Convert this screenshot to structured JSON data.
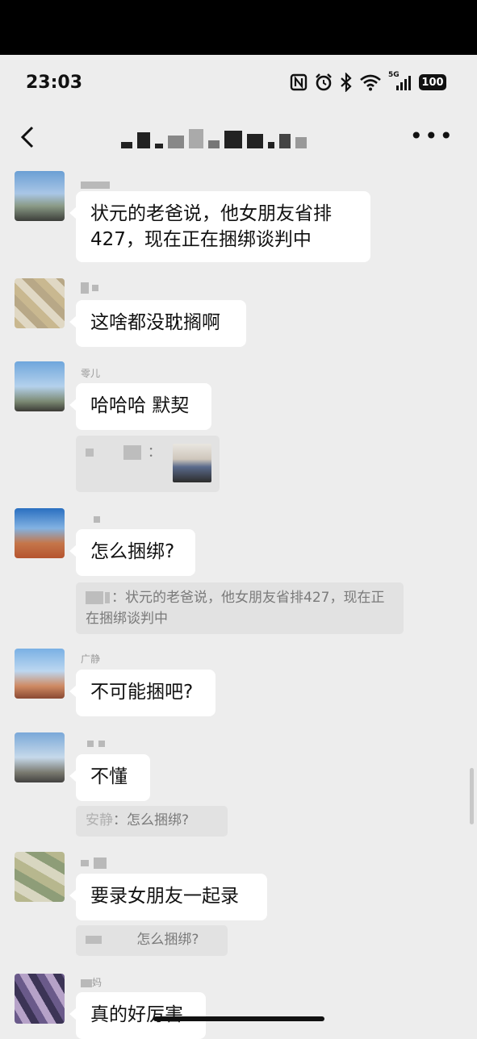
{
  "status": {
    "time": "23:03",
    "battery": "100",
    "network": "5G"
  },
  "header": {
    "title": ""
  },
  "messages": [
    {
      "avatar": "av-a",
      "text_line1": "状元的老爸说，他女朋友省排",
      "text_line2": "427，现在正在捆绑谈判中"
    },
    {
      "avatar": "av-b",
      "text": "这啥都没耽搁啊"
    },
    {
      "avatar": "av-c",
      "nick": "零儿",
      "text": "哈哈哈 默契",
      "quote": {
        "text": "："
      }
    },
    {
      "avatar": "av-d",
      "text": "怎么捆绑?",
      "quote": {
        "text": "：状元的老爸说，他女朋友省排427，现在正在捆绑谈判中"
      }
    },
    {
      "avatar": "av-e",
      "nick": "广静",
      "text": "不可能捆吧?"
    },
    {
      "avatar": "av-f",
      "text": "不懂",
      "quote": {
        "prefix": "安静",
        "text": "：怎么捆绑?"
      }
    },
    {
      "avatar": "av-g",
      "text": "要录女朋友一起录",
      "quote": {
        "text": "怎么捆绑?"
      }
    },
    {
      "avatar": "av-h",
      "nick": "妈",
      "text": "真的好厉害"
    }
  ],
  "icons": [
    "back-arrow-icon",
    "more-icon",
    "nfc-icon",
    "alarm-icon",
    "bluetooth-icon",
    "wifi-icon",
    "signal-icon",
    "battery-icon"
  ]
}
